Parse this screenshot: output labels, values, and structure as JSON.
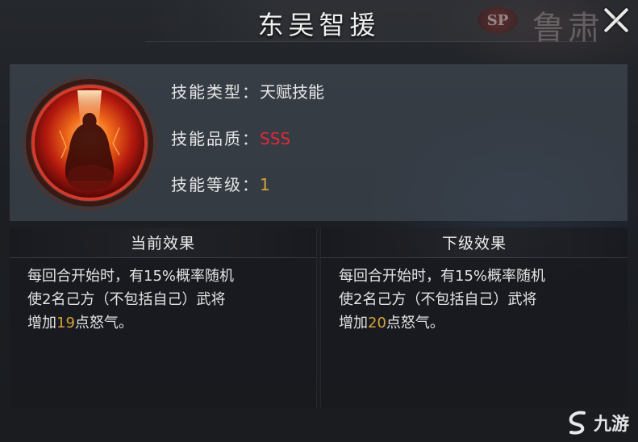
{
  "window": {
    "title": "东吴智援",
    "close_label": "×"
  },
  "background": {
    "sp_badge": "SP",
    "hero_name": "鲁肃"
  },
  "skill": {
    "icon": "flame-figure-icon",
    "type_label": "技能类型：",
    "type_value": "天赋技能",
    "quality_label": "技能品质：",
    "quality_value": "SSS",
    "level_label": "技能等级：",
    "level_value": "1"
  },
  "effects": {
    "current": {
      "header": "当前效果",
      "line1": "每回合开始时，有15%概率随机",
      "line2": "使2名己方（不包括自己）武将",
      "line3_pre": "增加",
      "line3_num": "19",
      "line3_post": "点怒气。"
    },
    "next": {
      "header": "下级效果",
      "line1": "每回合开始时，有15%概率随机",
      "line2": "使2名己方（不包括自己）武将",
      "line3_pre": "增加",
      "line3_num": "20",
      "line3_post": "点怒气。"
    }
  },
  "watermark": {
    "text": "九游",
    "icon": "jiuyou-logo-icon"
  },
  "colors": {
    "quality_red": "#e0293a",
    "value_gold": "#d8a23a",
    "panel": "#3e4650"
  }
}
